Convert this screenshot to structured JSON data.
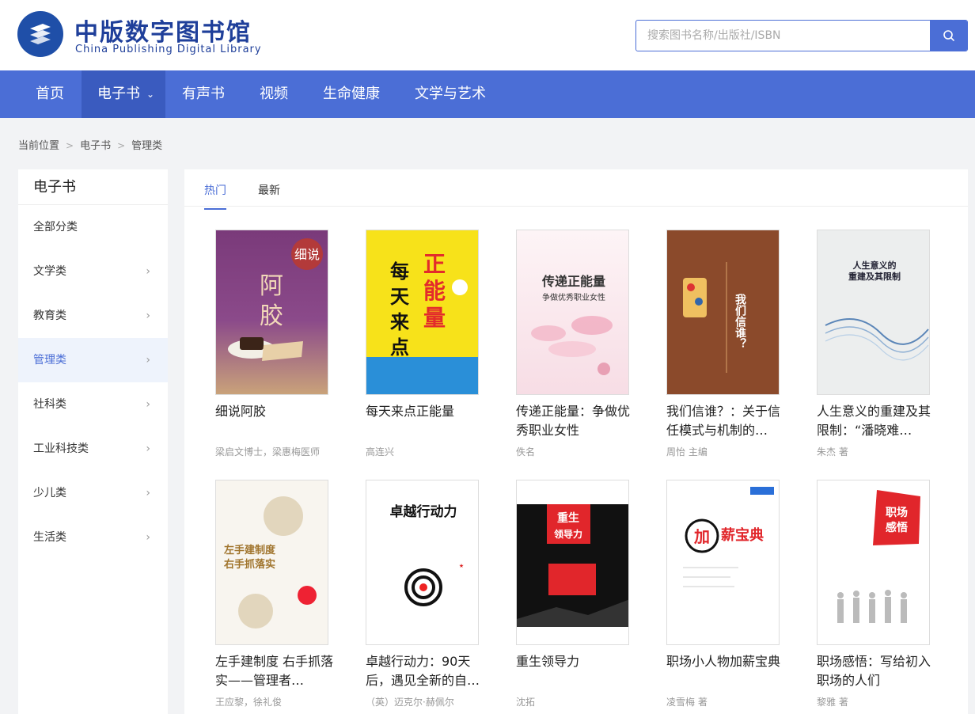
{
  "header": {
    "logo_cn": "中版数字图书馆",
    "logo_en": "China Publishing Digital Library",
    "search_placeholder": "搜索图书名称/出版社/ISBN"
  },
  "nav": {
    "items": [
      {
        "label": "首页"
      },
      {
        "label": "电子书",
        "active": true
      },
      {
        "label": "有声书"
      },
      {
        "label": "视频"
      },
      {
        "label": "生命健康"
      },
      {
        "label": "文学与艺术"
      }
    ]
  },
  "breadcrumb": [
    "当前位置",
    "电子书",
    "管理类"
  ],
  "sidebar": {
    "title": "电子书",
    "items": [
      {
        "label": "全部分类"
      },
      {
        "label": "文学类"
      },
      {
        "label": "教育类"
      },
      {
        "label": "管理类",
        "active": true
      },
      {
        "label": "社科类"
      },
      {
        "label": "工业科技类"
      },
      {
        "label": "少儿类"
      },
      {
        "label": "生活类"
      }
    ]
  },
  "tabs": [
    {
      "label": "热门",
      "active": true
    },
    {
      "label": "最新"
    }
  ],
  "books": [
    {
      "title": "细说阿胶",
      "author": "梁启文博士，梁惠梅医师",
      "cover_text": "细说阿胶"
    },
    {
      "title": "每天来点正能量",
      "author": "高连兴",
      "cover_text": "每天来点正能量"
    },
    {
      "title": "传递正能量：争做优秀职业女性",
      "author": "佚名",
      "cover_text": "传递正能量"
    },
    {
      "title": "我们信谁？：关于信任模式与机制的…",
      "author": "周怡 主编",
      "cover_text": "我们信谁？"
    },
    {
      "title": "人生意义的重建及其限制：“潘晓难…",
      "author": "朱杰 著",
      "cover_text": "人生意义的重建及其限制"
    },
    {
      "title": "左手建制度 右手抓落实——管理者…",
      "author": "王应黎，徐礼俊",
      "cover_text": "左手建制度右手抓落实"
    },
    {
      "title": "卓越行动力：90天后，遇见全新的自…",
      "author": "（英）迈克尔·赫佩尔",
      "cover_text": "卓越行动力"
    },
    {
      "title": "重生领导力",
      "author": "沈拓",
      "cover_text": "重生领导力"
    },
    {
      "title": "职场小人物加薪宝典",
      "author": "凌雪梅 著",
      "cover_text": "职场小人物加薪宝典"
    },
    {
      "title": "职场感悟：写给初入职场的人们",
      "author": "黎雅 著",
      "cover_text": "职场感悟"
    }
  ]
}
